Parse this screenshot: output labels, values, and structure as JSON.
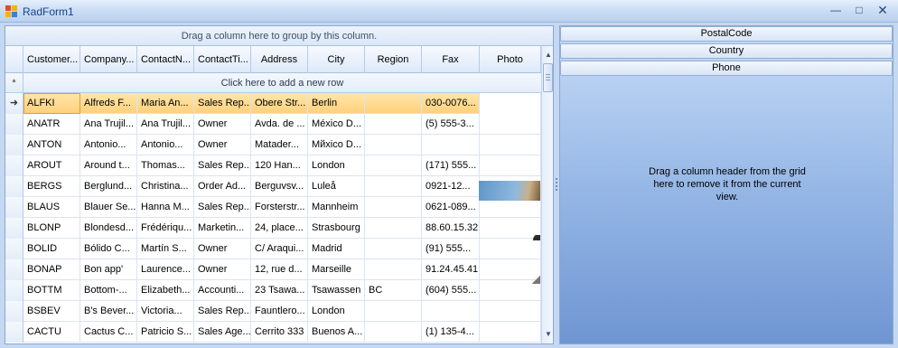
{
  "window": {
    "title": "RadForm1",
    "minimize_glyph": "—",
    "maximize_glyph": "□",
    "close_glyph": "✕"
  },
  "grid": {
    "group_panel_text": "Drag a column here to group by this column.",
    "new_row_text": "Click here to add a new row",
    "new_row_glyph": "*",
    "current_row_glyph": "➜",
    "columns": [
      {
        "label": "Customer...",
        "align": "left"
      },
      {
        "label": "Company...",
        "align": "left"
      },
      {
        "label": "ContactN...",
        "align": "left"
      },
      {
        "label": "ContactTi...",
        "align": "left"
      },
      {
        "label": "Address",
        "align": "center"
      },
      {
        "label": "City",
        "align": "center"
      },
      {
        "label": "Region",
        "align": "center"
      },
      {
        "label": "Fax",
        "align": "center"
      },
      {
        "label": "Photo",
        "align": "center"
      }
    ],
    "rows": [
      {
        "id": "ALFKI",
        "company": "Alfreds F...",
        "contact": "Maria An...",
        "title": "Sales Rep...",
        "address": "Obere Str...",
        "city": "Berlin",
        "region": "",
        "fax": "030-0076..."
      },
      {
        "id": "ANATR",
        "company": "Ana Trujil...",
        "contact": "Ana Trujil...",
        "title": "Owner",
        "address": "Avda. de ...",
        "city": "México D...",
        "region": "",
        "fax": "(5) 555-3..."
      },
      {
        "id": "ANTON",
        "company": "Antonio...",
        "contact": "Antonio...",
        "title": "Owner",
        "address": "Matader...",
        "city": "Mйxico D...",
        "region": "",
        "fax": ""
      },
      {
        "id": "AROUT",
        "company": "Around t...",
        "contact": "Thomas...",
        "title": "Sales Rep...",
        "address": "120 Han...",
        "city": "London",
        "region": "",
        "fax": "(171) 555..."
      },
      {
        "id": "BERGS",
        "company": "Berglund...",
        "contact": "Christina...",
        "title": "Order Ad...",
        "address": "Berguvsv...",
        "city": "Luleå",
        "region": "",
        "fax": "0921-12..."
      },
      {
        "id": "BLAUS",
        "company": "Blauer Se...",
        "contact": "Hanna M...",
        "title": "Sales Rep...",
        "address": "Forsterstr...",
        "city": "Mannheim",
        "region": "",
        "fax": "0621-089..."
      },
      {
        "id": "BLONP",
        "company": "Blondesd...",
        "contact": "Frédériqu...",
        "title": "Marketin...",
        "address": "24, place...",
        "city": "Strasbourg",
        "region": "",
        "fax": "88.60.15.32"
      },
      {
        "id": "BOLID",
        "company": "Bólido C...",
        "contact": "Martín S...",
        "title": "Owner",
        "address": "C/ Araqui...",
        "city": "Madrid",
        "region": "",
        "fax": "(91) 555..."
      },
      {
        "id": "BONAP",
        "company": "Bon app'",
        "contact": "Laurence...",
        "title": "Owner",
        "address": "12, rue d...",
        "city": "Marseille",
        "region": "",
        "fax": "91.24.45.41"
      },
      {
        "id": "BOTTM",
        "company": "Bottom-...",
        "contact": "Elizabeth...",
        "title": "Accounti...",
        "address": "23 Tsawa...",
        "city": "Tsawassen",
        "region": "BC",
        "fax": "(604) 555..."
      },
      {
        "id": "BSBEV",
        "company": "B's Bever...",
        "contact": "Victoria...",
        "title": "Sales Rep...",
        "address": "Fauntlero...",
        "city": "London",
        "region": "",
        "fax": ""
      },
      {
        "id": "CACTU",
        "company": "Cactus C...",
        "contact": "Patricio S...",
        "title": "Sales Age...",
        "address": "Cerrito 333",
        "city": "Buenos A...",
        "region": "",
        "fax": "(1) 135-4..."
      }
    ]
  },
  "scrollbar": {
    "up_glyph": "▲",
    "down_glyph": "▼"
  },
  "column_chooser": {
    "hidden_columns": [
      "PostalCode",
      "Country",
      "Phone"
    ],
    "hint": "Drag a column header from the grid here to remove it from the current view."
  },
  "colors": {
    "selected_row": "#ffd17c",
    "accent": "#15428b",
    "panel_gradient_bottom": "#6f95d2"
  }
}
